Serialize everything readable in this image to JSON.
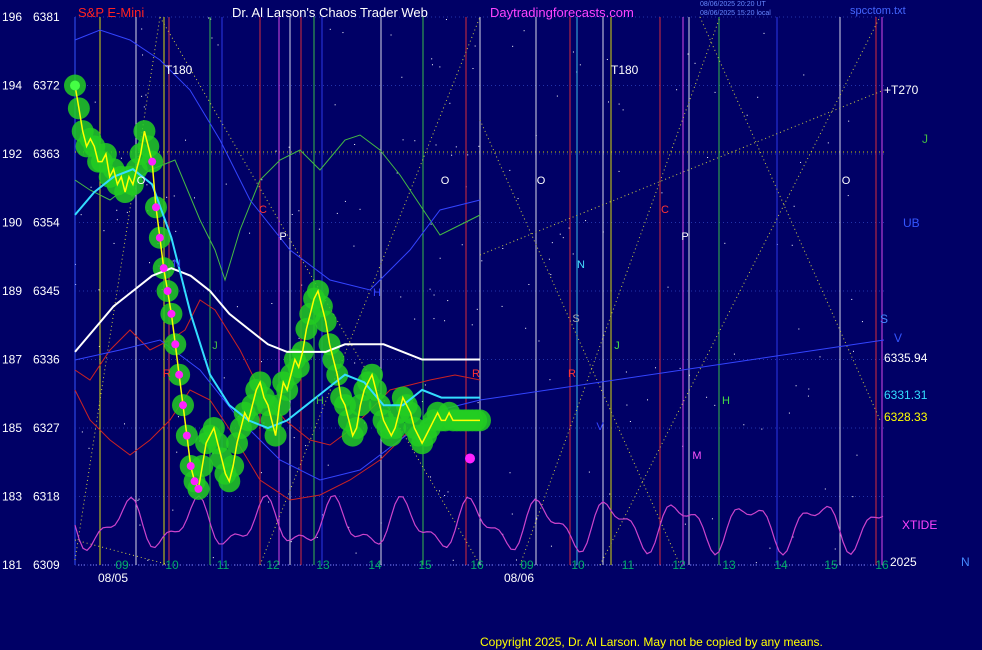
{
  "header": {
    "symbol": "S&P E-Mini",
    "site": "Dr. Al Larson's Chaos Trader Web",
    "url": "Daytradingforecasts.com",
    "timestamp1": "08/06/2025 20:20 UT",
    "timestamp2": "08/06/2025 15:20 local",
    "file": "spcctom.txt"
  },
  "footer": {
    "copyright": "Copyright 2025, Dr. Al Larson. May not be copied by any means."
  },
  "colors": {
    "background": "#000066",
    "price": "#ffff00",
    "price_glow": "#22cc22",
    "avg_white": "#ffffff",
    "avg_cyan": "#33ddff",
    "tide": "#cc44cc",
    "red_line": "#cc2222",
    "green_line": "#44bb44",
    "blue_line": "#3344ff"
  },
  "chart_data": {
    "type": "line",
    "title": "S&P E-Mini",
    "y_left_ticks": [
      "196",
      "194",
      "192",
      "190",
      "189",
      "187",
      "185",
      "183",
      "181"
    ],
    "y_right_ticks": [
      "6381",
      "6372",
      "6363",
      "6354",
      "6345",
      "6336",
      "6327",
      "6318",
      "6309"
    ],
    "ylim": [
      6309,
      6381
    ],
    "x_hour_labels_day1": [
      "09",
      "10",
      "11",
      "12",
      "13",
      "14",
      "15",
      "16"
    ],
    "x_hour_labels_day2": [
      "09",
      "10",
      "11",
      "12",
      "13",
      "14",
      "15",
      "16"
    ],
    "dates": [
      "08/05",
      "08/06"
    ],
    "price_levels": [
      {
        "label": "6335.94",
        "value": 6335.94,
        "color": "#ffffff"
      },
      {
        "label": "6331.31",
        "value": 6331.31,
        "color": "#33ddff"
      },
      {
        "label": "6328.33",
        "value": 6328.33,
        "color": "#ffff00"
      }
    ],
    "annotations": {
      "t180_a": "T180",
      "t180_b": "T180",
      "t270": "+T270",
      "xtide": "XTIDE",
      "year": "2025",
      "corner_n": "N",
      "j_right": "J",
      "ub_right": "UB",
      "s_right": "S",
      "v_right": "V"
    },
    "markers": [
      {
        "t": "O"
      },
      {
        "t": "C"
      },
      {
        "t": "P"
      },
      {
        "t": "O"
      },
      {
        "t": "O"
      },
      {
        "t": "C"
      },
      {
        "t": "P"
      },
      {
        "t": "O"
      },
      {
        "t": "N"
      },
      {
        "t": "J"
      },
      {
        "t": "H"
      },
      {
        "t": "R"
      },
      {
        "t": "H"
      },
      {
        "t": "M"
      },
      {
        "t": "J"
      },
      {
        "t": "S"
      },
      {
        "t": "R"
      },
      {
        "t": "R"
      },
      {
        "t": "V"
      },
      {
        "t": "H"
      },
      {
        "t": "N"
      }
    ],
    "series": [
      {
        "name": "price",
        "x": [
          0,
          2,
          4,
          6,
          8,
          10,
          12,
          14,
          16,
          18,
          20,
          22,
          24,
          26,
          28,
          30,
          32,
          34,
          36,
          38,
          40,
          42,
          44,
          46,
          48,
          50,
          52,
          54,
          56,
          58,
          60,
          62,
          64,
          66,
          68,
          70,
          72,
          74,
          76,
          78,
          80,
          82,
          84,
          86,
          88,
          90,
          92,
          94,
          96,
          98,
          100,
          102,
          104,
          106,
          108,
          110,
          112,
          114,
          116,
          118,
          120,
          122,
          124,
          126,
          128,
          130,
          132,
          134,
          136,
          138,
          140,
          142,
          144,
          146,
          148,
          150,
          152,
          154,
          156,
          158,
          160,
          162,
          164,
          166,
          168,
          170,
          172,
          174,
          176,
          178,
          180,
          182,
          184,
          186,
          188,
          190,
          192,
          194,
          196,
          198,
          200,
          202,
          204,
          206,
          208,
          210
        ],
        "y": [
          6372,
          6369,
          6366,
          6364,
          6365,
          6364,
          6362,
          6362,
          6363,
          6360,
          6361,
          6359,
          6360,
          6358,
          6360,
          6359,
          6361,
          6363,
          6366,
          6364,
          6362,
          6356,
          6352,
          6348,
          6345,
          6342,
          6338,
          6334,
          6330,
          6326,
          6322,
          6320,
          6319,
          6322,
          6325,
          6326,
          6327,
          6325,
          6323,
          6321,
          6320,
          6322,
          6325,
          6327,
          6329,
          6328,
          6330,
          6332,
          6333,
          6331,
          6330,
          6328,
          6326,
          6330,
          6333,
          6332,
          6334,
          6336,
          6335,
          6337,
          6340,
          6342,
          6344,
          6345,
          6343,
          6341,
          6338,
          6336,
          6334,
          6331,
          6330,
          6328,
          6326,
          6327,
          6330,
          6332,
          6333,
          6334,
          6332,
          6330,
          6328,
          6327,
          6326,
          6327,
          6329,
          6331,
          6330,
          6329,
          6327,
          6326,
          6325,
          6326,
          6327,
          6328,
          6329,
          6328,
          6328,
          6329,
          6328,
          6328,
          6328,
          6328,
          6328,
          6328,
          6328,
          6328
        ]
      },
      {
        "name": "average-white",
        "x": [
          0,
          10,
          20,
          30,
          40,
          50,
          60,
          70,
          80,
          90,
          100,
          110,
          120,
          130,
          140,
          150,
          160,
          170,
          180,
          190,
          200,
          210
        ],
        "y": [
          6337,
          6340,
          6343,
          6345,
          6347,
          6348,
          6347,
          6345,
          6342,
          6340,
          6338,
          6337,
          6337,
          6337,
          6338,
          6338,
          6338,
          6337,
          6336,
          6336,
          6336,
          6336
        ]
      },
      {
        "name": "average-cyan",
        "x": [
          0,
          10,
          20,
          30,
          40,
          50,
          60,
          70,
          80,
          90,
          100,
          110,
          120,
          130,
          140,
          150,
          160,
          170,
          180,
          190,
          200,
          210
        ],
        "y": [
          6355,
          6358,
          6360,
          6361,
          6359,
          6352,
          6342,
          6334,
          6330,
          6328,
          6327,
          6328,
          6330,
          6332,
          6334,
          6333,
          6330,
          6330,
          6332,
          6331,
          6331,
          6331
        ]
      }
    ]
  }
}
